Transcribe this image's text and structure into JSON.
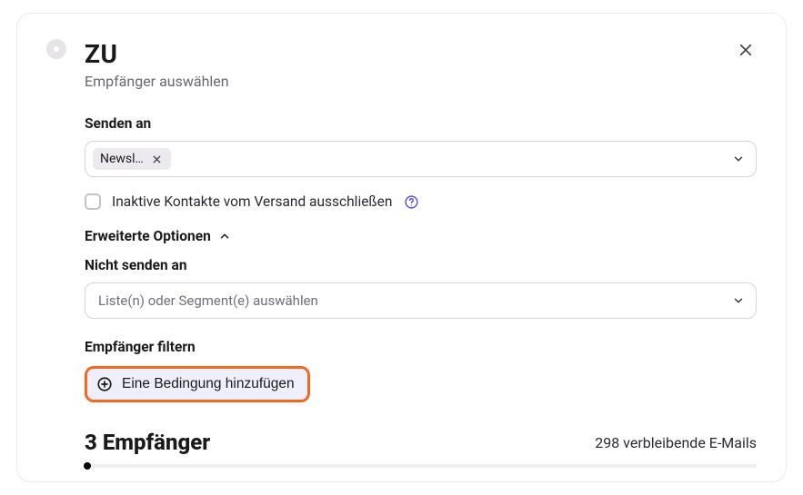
{
  "header": {
    "title": "ZU",
    "subtitle": "Empfänger auswählen"
  },
  "send_to": {
    "label": "Senden an",
    "chip_label": "Newsl…"
  },
  "exclude_inactive_label": "Inaktive Kontakte vom Versand ausschließen",
  "advanced_label": "Erweiterte Optionen",
  "dont_send_to": {
    "label": "Nicht senden an",
    "placeholder": "Liste(n) oder Segment(e) auswählen"
  },
  "filter": {
    "label": "Empfänger filtern",
    "add_button": "Eine Bedingung hinzufügen"
  },
  "summary": {
    "left": "3 Empfänger",
    "right": "298 verbleibende E-Mails"
  }
}
